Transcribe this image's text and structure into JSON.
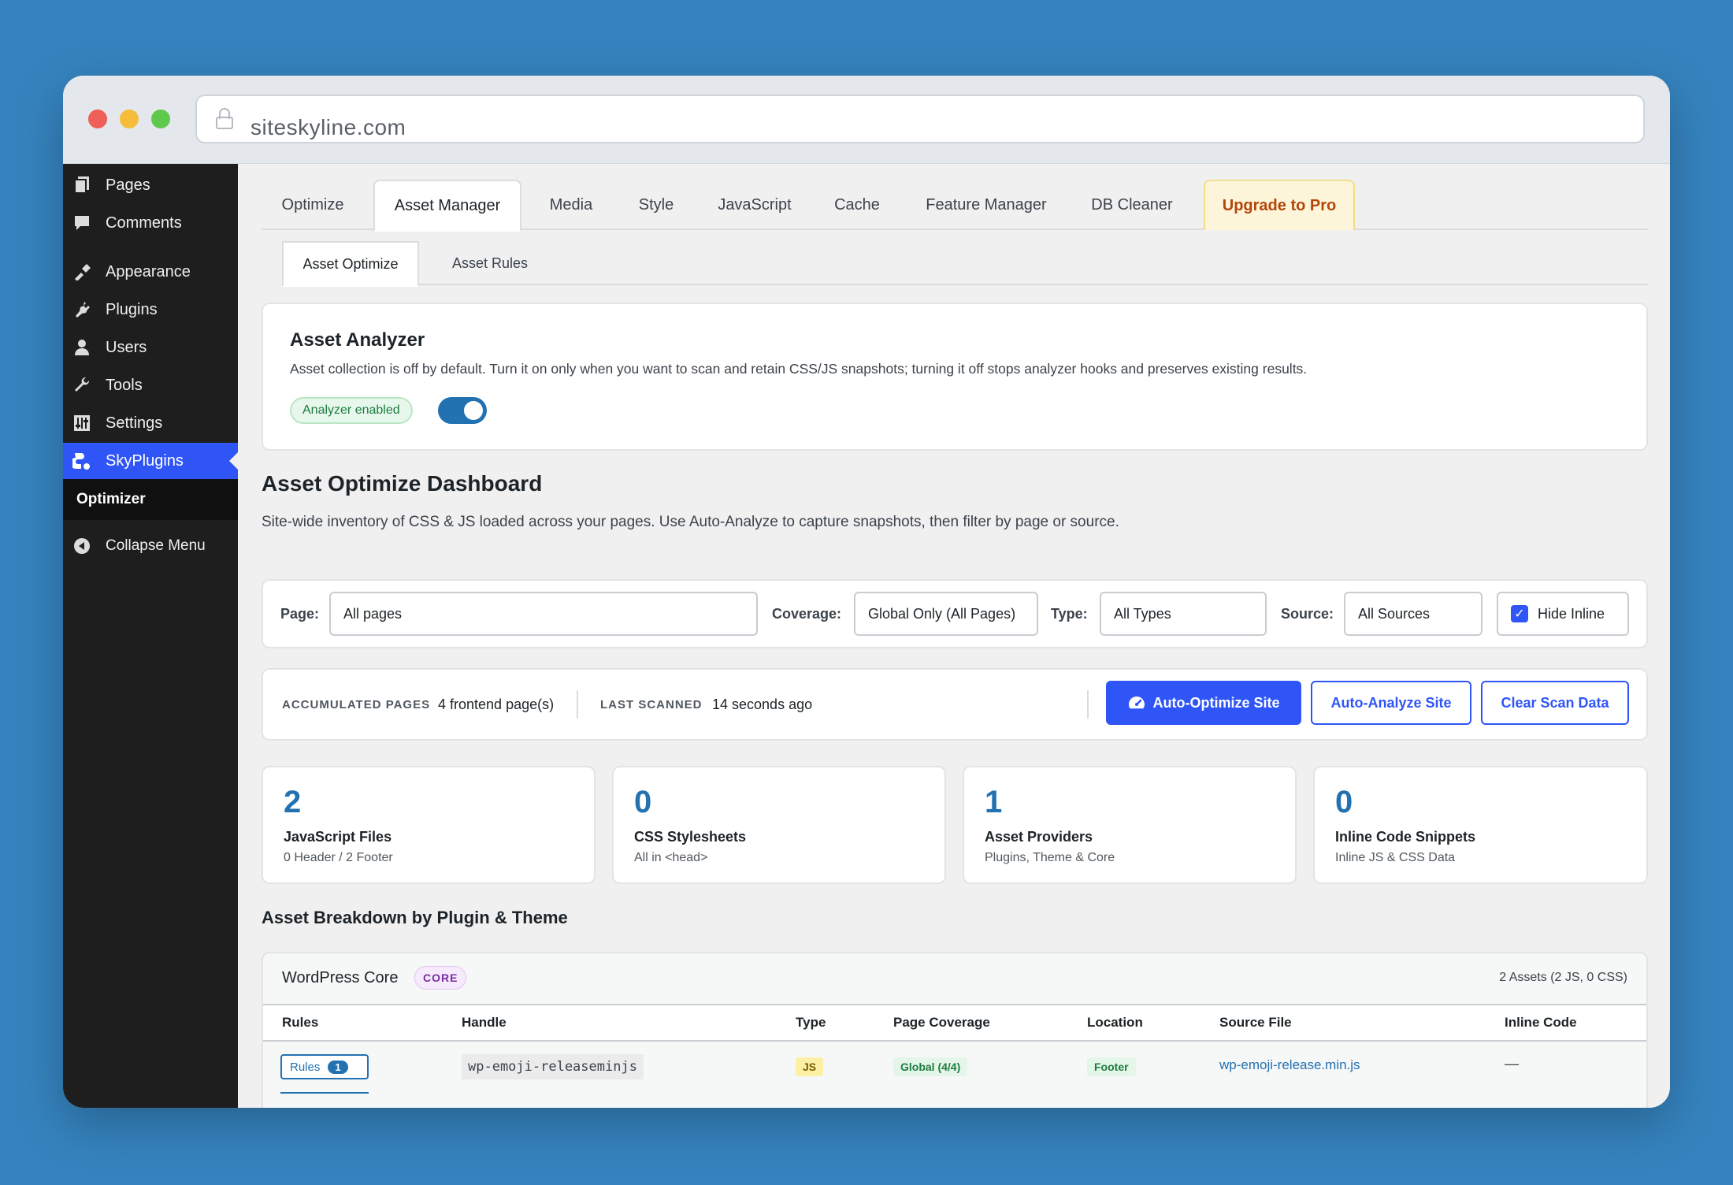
{
  "browser": {
    "url": "siteskyline.com"
  },
  "sidebar": {
    "items": [
      {
        "label": "Pages",
        "icon": "pages-icon"
      },
      {
        "label": "Comments",
        "icon": "comments-icon"
      },
      {
        "label": "Appearance",
        "icon": "appearance-icon"
      },
      {
        "label": "Plugins",
        "icon": "plugins-icon"
      },
      {
        "label": "Users",
        "icon": "users-icon"
      },
      {
        "label": "Tools",
        "icon": "tools-icon"
      },
      {
        "label": "Settings",
        "icon": "settings-icon"
      },
      {
        "label": "SkyPlugins",
        "icon": "skyplugins-icon",
        "active": true
      }
    ],
    "submenu_active": "Optimizer",
    "collapse_label": "Collapse Menu"
  },
  "tabs": [
    "Optimize",
    "Asset Manager",
    "Media",
    "Style",
    "JavaScript",
    "Cache",
    "Feature Manager",
    "DB Cleaner",
    "Upgrade to Pro"
  ],
  "active_tab": "Asset Manager",
  "subtabs": [
    "Asset Optimize",
    "Asset Rules"
  ],
  "active_subtab": "Asset Optimize",
  "analyzer": {
    "title": "Asset Analyzer",
    "description": "Asset collection is off by default. Turn it on only when you want to scan and retain CSS/JS snapshots; turning it off stops analyzer hooks and preserves existing results.",
    "status_label": "Analyzer enabled",
    "enabled": true
  },
  "dashboard": {
    "title": "Asset Optimize Dashboard",
    "description": "Site-wide inventory of CSS & JS loaded across your pages. Use Auto-Analyze to capture snapshots, then filter by page or source."
  },
  "filters": {
    "page_label": "Page:",
    "page_value": "All pages",
    "coverage_label": "Coverage:",
    "coverage_value": "Global Only (All Pages)",
    "type_label": "Type:",
    "type_value": "All Types",
    "source_label": "Source:",
    "source_value": "All Sources",
    "hide_inline_label": "Hide Inline",
    "hide_inline_checked": true
  },
  "scan_meta": {
    "accumulated_label": "ACCUMULATED PAGES",
    "accumulated_value": "4 frontend page(s)",
    "last_scanned_label": "LAST SCANNED",
    "last_scanned_value": "14 seconds ago",
    "auto_optimize_label": "Auto-Optimize Site",
    "auto_analyze_label": "Auto-Analyze Site",
    "clear_label": "Clear Scan Data"
  },
  "stats": [
    {
      "value": "2",
      "label": "JavaScript Files",
      "sub": "0 Header / 2 Footer"
    },
    {
      "value": "0",
      "label": "CSS Stylesheets",
      "sub": "All in <head>"
    },
    {
      "value": "1",
      "label": "Asset Providers",
      "sub": "Plugins, Theme & Core"
    },
    {
      "value": "0",
      "label": "Inline Code Snippets",
      "sub": "Inline JS & CSS Data"
    }
  ],
  "breakdown": {
    "title": "Asset Breakdown by Plugin & Theme",
    "group_name": "WordPress Core",
    "group_badge": "CORE",
    "group_count": "2 Assets (2 JS, 0 CSS)",
    "columns": [
      "Rules",
      "Handle",
      "Type",
      "Page Coverage",
      "Location",
      "Source File",
      "Inline Code"
    ],
    "rows": [
      {
        "rules_label": "Rules",
        "rules_count": "1",
        "handle": "wp-emoji-releaseminjs",
        "type": "JS",
        "coverage": "Global (4/4)",
        "location": "Footer",
        "source": "wp-emoji-release.min.js",
        "inline": "—"
      }
    ]
  },
  "colors": {
    "accent": "#2f55f7",
    "wp_blue": "#2271b1",
    "sidebar_bg": "#1e1e1e",
    "pro_text": "#b3470b"
  }
}
